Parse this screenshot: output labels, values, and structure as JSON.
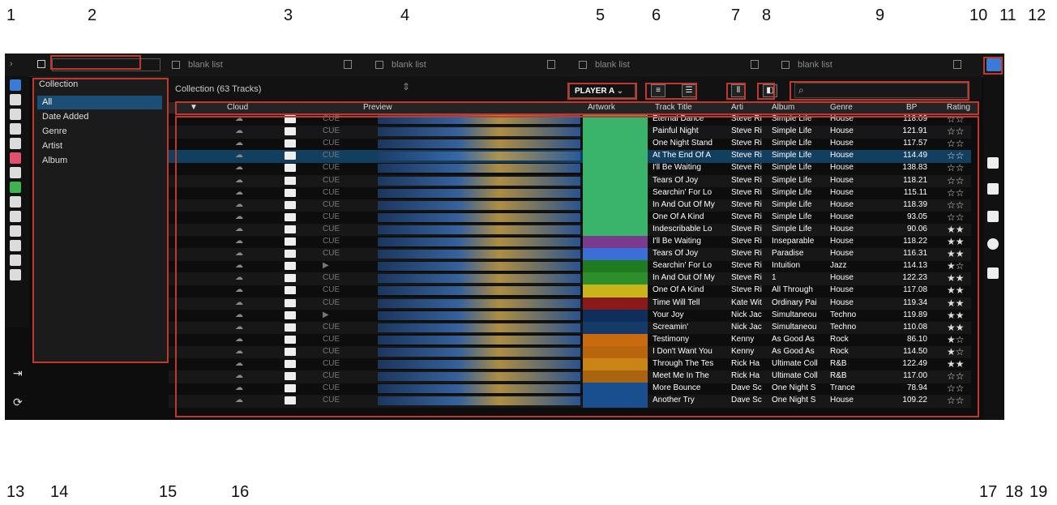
{
  "callouts": [
    "1",
    "2",
    "3",
    "4",
    "5",
    "6",
    "7",
    "8",
    "9",
    "10",
    "11",
    "12",
    "13",
    "14",
    "15",
    "16",
    "17",
    "18",
    "19"
  ],
  "tabs": [
    "blank list",
    "blank list",
    "blank list",
    "blank list"
  ],
  "tree": {
    "header": "Collection",
    "items": [
      "All",
      "Date Added",
      "Genre",
      "Artist",
      "Album"
    ],
    "selected": "All"
  },
  "toolbar": {
    "collection_title": "Collection (63 Tracks)",
    "player": "PLAYER A",
    "search_icon": "search-icon"
  },
  "columns": [
    "Cloud",
    "Preview",
    "Artwork",
    "Track Title",
    "Arti",
    "Album",
    "Genre",
    "BP",
    "Rating"
  ],
  "tracks": [
    {
      "title": "Eternal Dance",
      "artist": "Steve Ri",
      "album": "Simple Life",
      "genre": "House",
      "bpm": "118.09",
      "rating": "☆☆",
      "cue": "CUE"
    },
    {
      "title": "Painful Night",
      "artist": "Steve Ri",
      "album": "Simple Life",
      "genre": "House",
      "bpm": "121.91",
      "rating": "☆☆",
      "cue": "CUE"
    },
    {
      "title": "One Night Stand",
      "artist": "Steve Ri",
      "album": "Simple Life",
      "genre": "House",
      "bpm": "117.57",
      "rating": "☆☆",
      "cue": "CUE"
    },
    {
      "title": "At The End Of A",
      "artist": "Steve Ri",
      "album": "Simple Life",
      "genre": "House",
      "bpm": "114.49",
      "rating": "☆☆",
      "cue": "CUE"
    },
    {
      "title": "I'll Be Waiting",
      "artist": "Steve Ri",
      "album": "Simple Life",
      "genre": "House",
      "bpm": "138.83",
      "rating": "☆☆",
      "cue": "CUE"
    },
    {
      "title": "Tears Of Joy",
      "artist": "Steve Ri",
      "album": "Simple Life",
      "genre": "House",
      "bpm": "118.21",
      "rating": "☆☆",
      "cue": "CUE"
    },
    {
      "title": "Searchin' For Lo",
      "artist": "Steve Ri",
      "album": "Simple Life",
      "genre": "House",
      "bpm": "115.11",
      "rating": "☆☆",
      "cue": "CUE"
    },
    {
      "title": "In And Out Of My",
      "artist": "Steve Ri",
      "album": "Simple Life",
      "genre": "House",
      "bpm": "118.39",
      "rating": "☆☆",
      "cue": "CUE"
    },
    {
      "title": "One Of A Kind",
      "artist": "Steve Ri",
      "album": "Simple Life",
      "genre": "House",
      "bpm": "93.05",
      "rating": "☆☆",
      "cue": "CUE"
    },
    {
      "title": "Indescribable Lo",
      "artist": "Steve Ri",
      "album": "Simple Life",
      "genre": "House",
      "bpm": "90.06",
      "rating": "★★",
      "cue": "CUE"
    },
    {
      "title": "I'll Be Waiting",
      "artist": "Steve Ri",
      "album": "Inseparable",
      "genre": "House",
      "bpm": "118.22",
      "rating": "★★",
      "cue": "CUE"
    },
    {
      "title": "Tears Of Joy",
      "artist": "Steve Ri",
      "album": "Paradise",
      "genre": "House",
      "bpm": "116.31",
      "rating": "★★",
      "cue": "CUE"
    },
    {
      "title": "Searchin' For Lo",
      "artist": "Steve Ri",
      "album": "Intuition",
      "genre": "Jazz",
      "bpm": "114.13",
      "rating": "★☆",
      "cue": "▶"
    },
    {
      "title": "In And Out Of My",
      "artist": "Steve Ri",
      "album": "1",
      "genre": "House",
      "bpm": "122.23",
      "rating": "★★",
      "cue": "CUE"
    },
    {
      "title": "One Of A Kind",
      "artist": "Steve Ri",
      "album": "All Through",
      "genre": "House",
      "bpm": "117.08",
      "rating": "★★",
      "cue": "CUE"
    },
    {
      "title": "Time Will Tell",
      "artist": "Kate Wit",
      "album": "Ordinary Pai",
      "genre": "House",
      "bpm": "119.34",
      "rating": "★★",
      "cue": "CUE"
    },
    {
      "title": "Your Joy",
      "artist": "Nick Jac",
      "album": "Simultaneou",
      "genre": "Techno",
      "bpm": "119.89",
      "rating": "★★",
      "cue": "▶"
    },
    {
      "title": "Screamin'",
      "artist": "Nick Jac",
      "album": "Simultaneou",
      "genre": "Techno",
      "bpm": "110.08",
      "rating": "★★",
      "cue": "CUE"
    },
    {
      "title": "Testimony",
      "artist": "Kenny",
      "album": "As Good As",
      "genre": "Rock",
      "bpm": "86.10",
      "rating": "★☆",
      "cue": "CUE"
    },
    {
      "title": "I Don't Want You",
      "artist": "Kenny",
      "album": "As Good As",
      "genre": "Rock",
      "bpm": "114.50",
      "rating": "★☆",
      "cue": "CUE"
    },
    {
      "title": "Through The Tes",
      "artist": "Rick Ha",
      "album": "Ultimate Coll",
      "genre": "R&B",
      "bpm": "122.49",
      "rating": "★★",
      "cue": "CUE"
    },
    {
      "title": "Meet Me In The",
      "artist": "Rick Ha",
      "album": "Ultimate Coll",
      "genre": "R&B",
      "bpm": "117.00",
      "rating": "☆☆",
      "cue": "CUE"
    },
    {
      "title": "More Bounce",
      "artist": "Dave Sc",
      "album": "One Night S",
      "genre": "Trance",
      "bpm": "78.94",
      "rating": "☆☆",
      "cue": "CUE"
    },
    {
      "title": "Another Try",
      "artist": "Dave Sc",
      "album": "One Night S",
      "genre": "House",
      "bpm": "109.22",
      "rating": "☆☆",
      "cue": "CUE"
    }
  ],
  "selected_row": 3,
  "accent_color": "#3a7bd5",
  "highlight_color": "#c0392b"
}
